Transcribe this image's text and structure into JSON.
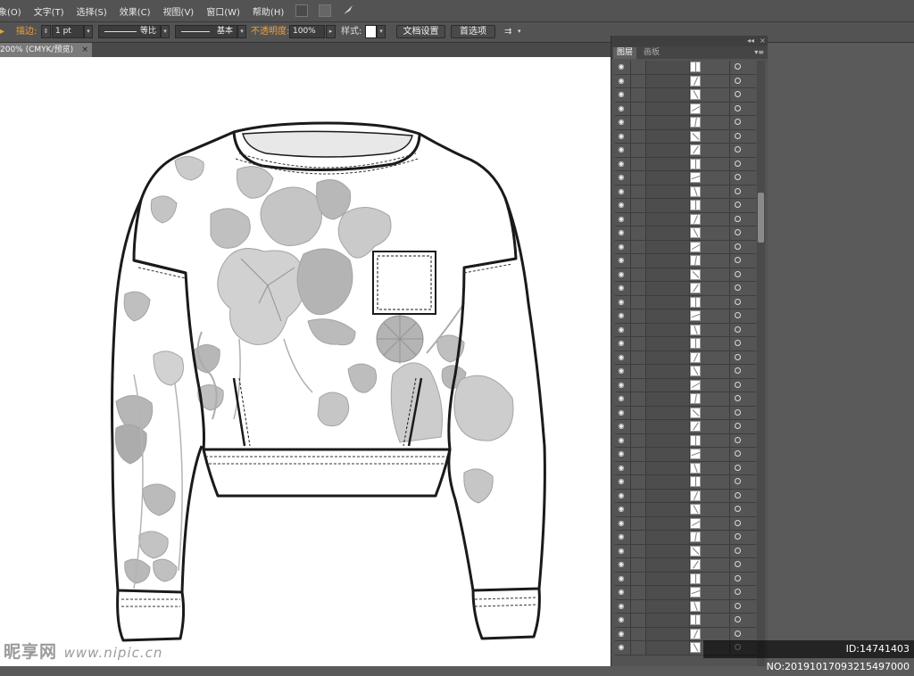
{
  "menubar": {
    "items": [
      "象(O)",
      "文字(T)",
      "选择(S)",
      "效果(C)",
      "视图(V)",
      "窗口(W)",
      "帮助(H)"
    ],
    "icons": [
      "bridge-icon",
      "arrange-documents-icon",
      "feather-icon"
    ]
  },
  "controlbar": {
    "stroke_label": "描边:",
    "stroke_weight": "1 pt",
    "profile_label": "等比",
    "brush_label": "基本",
    "opacity_label": "不透明度:",
    "opacity_value": "100%",
    "style_label": "样式:",
    "doc_setup": "文档设置",
    "preferences": "首选项"
  },
  "document": {
    "tab_title": "200% (CMYK/预览)",
    "close": "×"
  },
  "layers_panel": {
    "collapse": "◂◂",
    "close": "×",
    "tabs": [
      "图层",
      "画板"
    ],
    "menu": "▾≡",
    "row_count": 43
  },
  "watermark": {
    "logo": "昵享网",
    "url": "www.nipic.cn",
    "id_text": "ID:14741403 NO:20191017093215497000"
  },
  "colors": {
    "ui_bg": "#535353",
    "canvas": "#ffffff",
    "accent_label": "#f0a040",
    "print_gray": "#b4b4b4"
  }
}
